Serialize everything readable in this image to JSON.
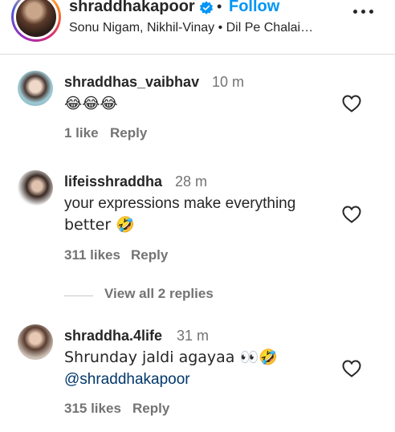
{
  "header": {
    "username": "shraddhakapoor",
    "separator": "•",
    "follow_label": "Follow",
    "audio": "Sonu Nigam, Nikhil-Vinay • Dil Pe Chalai…"
  },
  "comments": [
    {
      "username": "shraddhas_vaibhav",
      "time": "10 m",
      "text": "😂😂😂",
      "likes": "1 like",
      "reply_label": "Reply"
    },
    {
      "username": "lifeisshraddha",
      "time": "28 m",
      "text_line1": "your expressions make everything",
      "text_line2": "better 🤣",
      "likes": "311 likes",
      "reply_label": "Reply",
      "view_replies": "View all 2 replies"
    },
    {
      "username": "shraddha.4life",
      "time": "31 m",
      "text_line1": "Shrunday jaldi agayaa 👀🤣",
      "mention": "@shraddhakapoor",
      "likes": "315 likes",
      "reply_label": "Reply"
    }
  ],
  "colors": {
    "follow": "#0095f6",
    "mention": "#00376b",
    "secondary_text": "#737373"
  },
  "icons": [
    "verified-badge-icon",
    "more-options-icon",
    "heart-icon"
  ]
}
